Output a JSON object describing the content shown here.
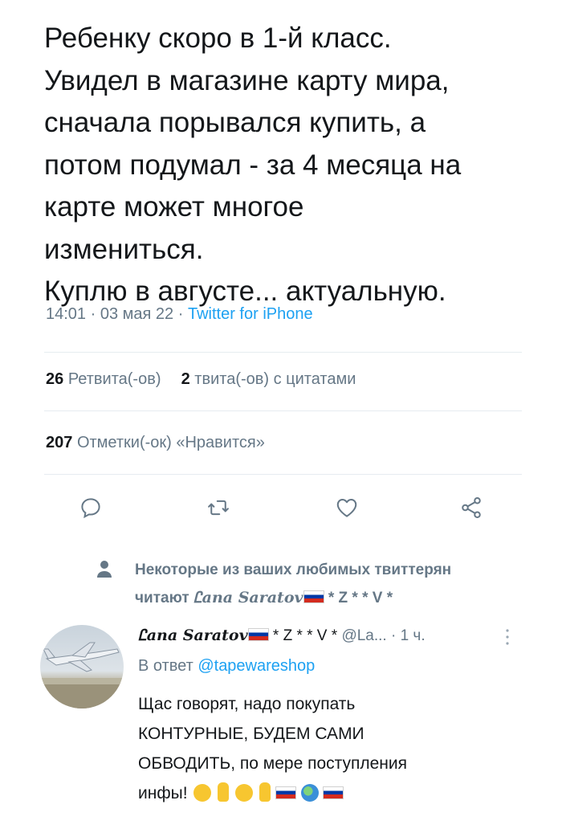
{
  "tweet": {
    "text_lines": [
      "Ребенку скоро в 1-й класс.",
      "Увидел в магазине карту мира,",
      "сначала порывался купить, а",
      "потом подумал - за 4 месяца на",
      "карте может многое",
      "измениться.",
      "Куплю в августе... актуальную."
    ],
    "time": "14:01",
    "date": "03 мая 22",
    "separator": "·",
    "source": "Twitter for iPhone"
  },
  "stats": {
    "retweets_count": "26",
    "retweets_label": "Ретвита(-ов)",
    "quotes_count": "2",
    "quotes_label": "твита(-ов) с цитатами",
    "likes_count": "207",
    "likes_label": "Отметки(-ок) «Нравится»"
  },
  "actions": {
    "reply_icon": "reply-icon",
    "retweet_icon": "retweet-icon",
    "like_icon": "heart-icon",
    "share_icon": "share-icon"
  },
  "social_context": {
    "line1": "Некоторые из ваших любимых твиттерян",
    "line2_prefix": "читают",
    "line2_name": "Ꮭana Saratov",
    "line2_suffix": "* Z * * V *"
  },
  "reply": {
    "name": "Ꮭana Saratov",
    "name_suffix": "* Z * * V *",
    "handle": "@La...",
    "time": "· 1 ч.",
    "reply_to_label": "В ответ",
    "reply_to_handle": "@tapewareshop",
    "text_lines": [
      "Щас говорят, надо покупать",
      "КОНТУРНЫЕ, БУДЕМ САМИ",
      "ОБВОДИТЬ,  по мере поступления",
      "инфы!"
    ]
  },
  "colors": {
    "accent": "#1da1f2",
    "muted": "#657786",
    "text": "#14171a",
    "divider": "#e6ecf0"
  }
}
